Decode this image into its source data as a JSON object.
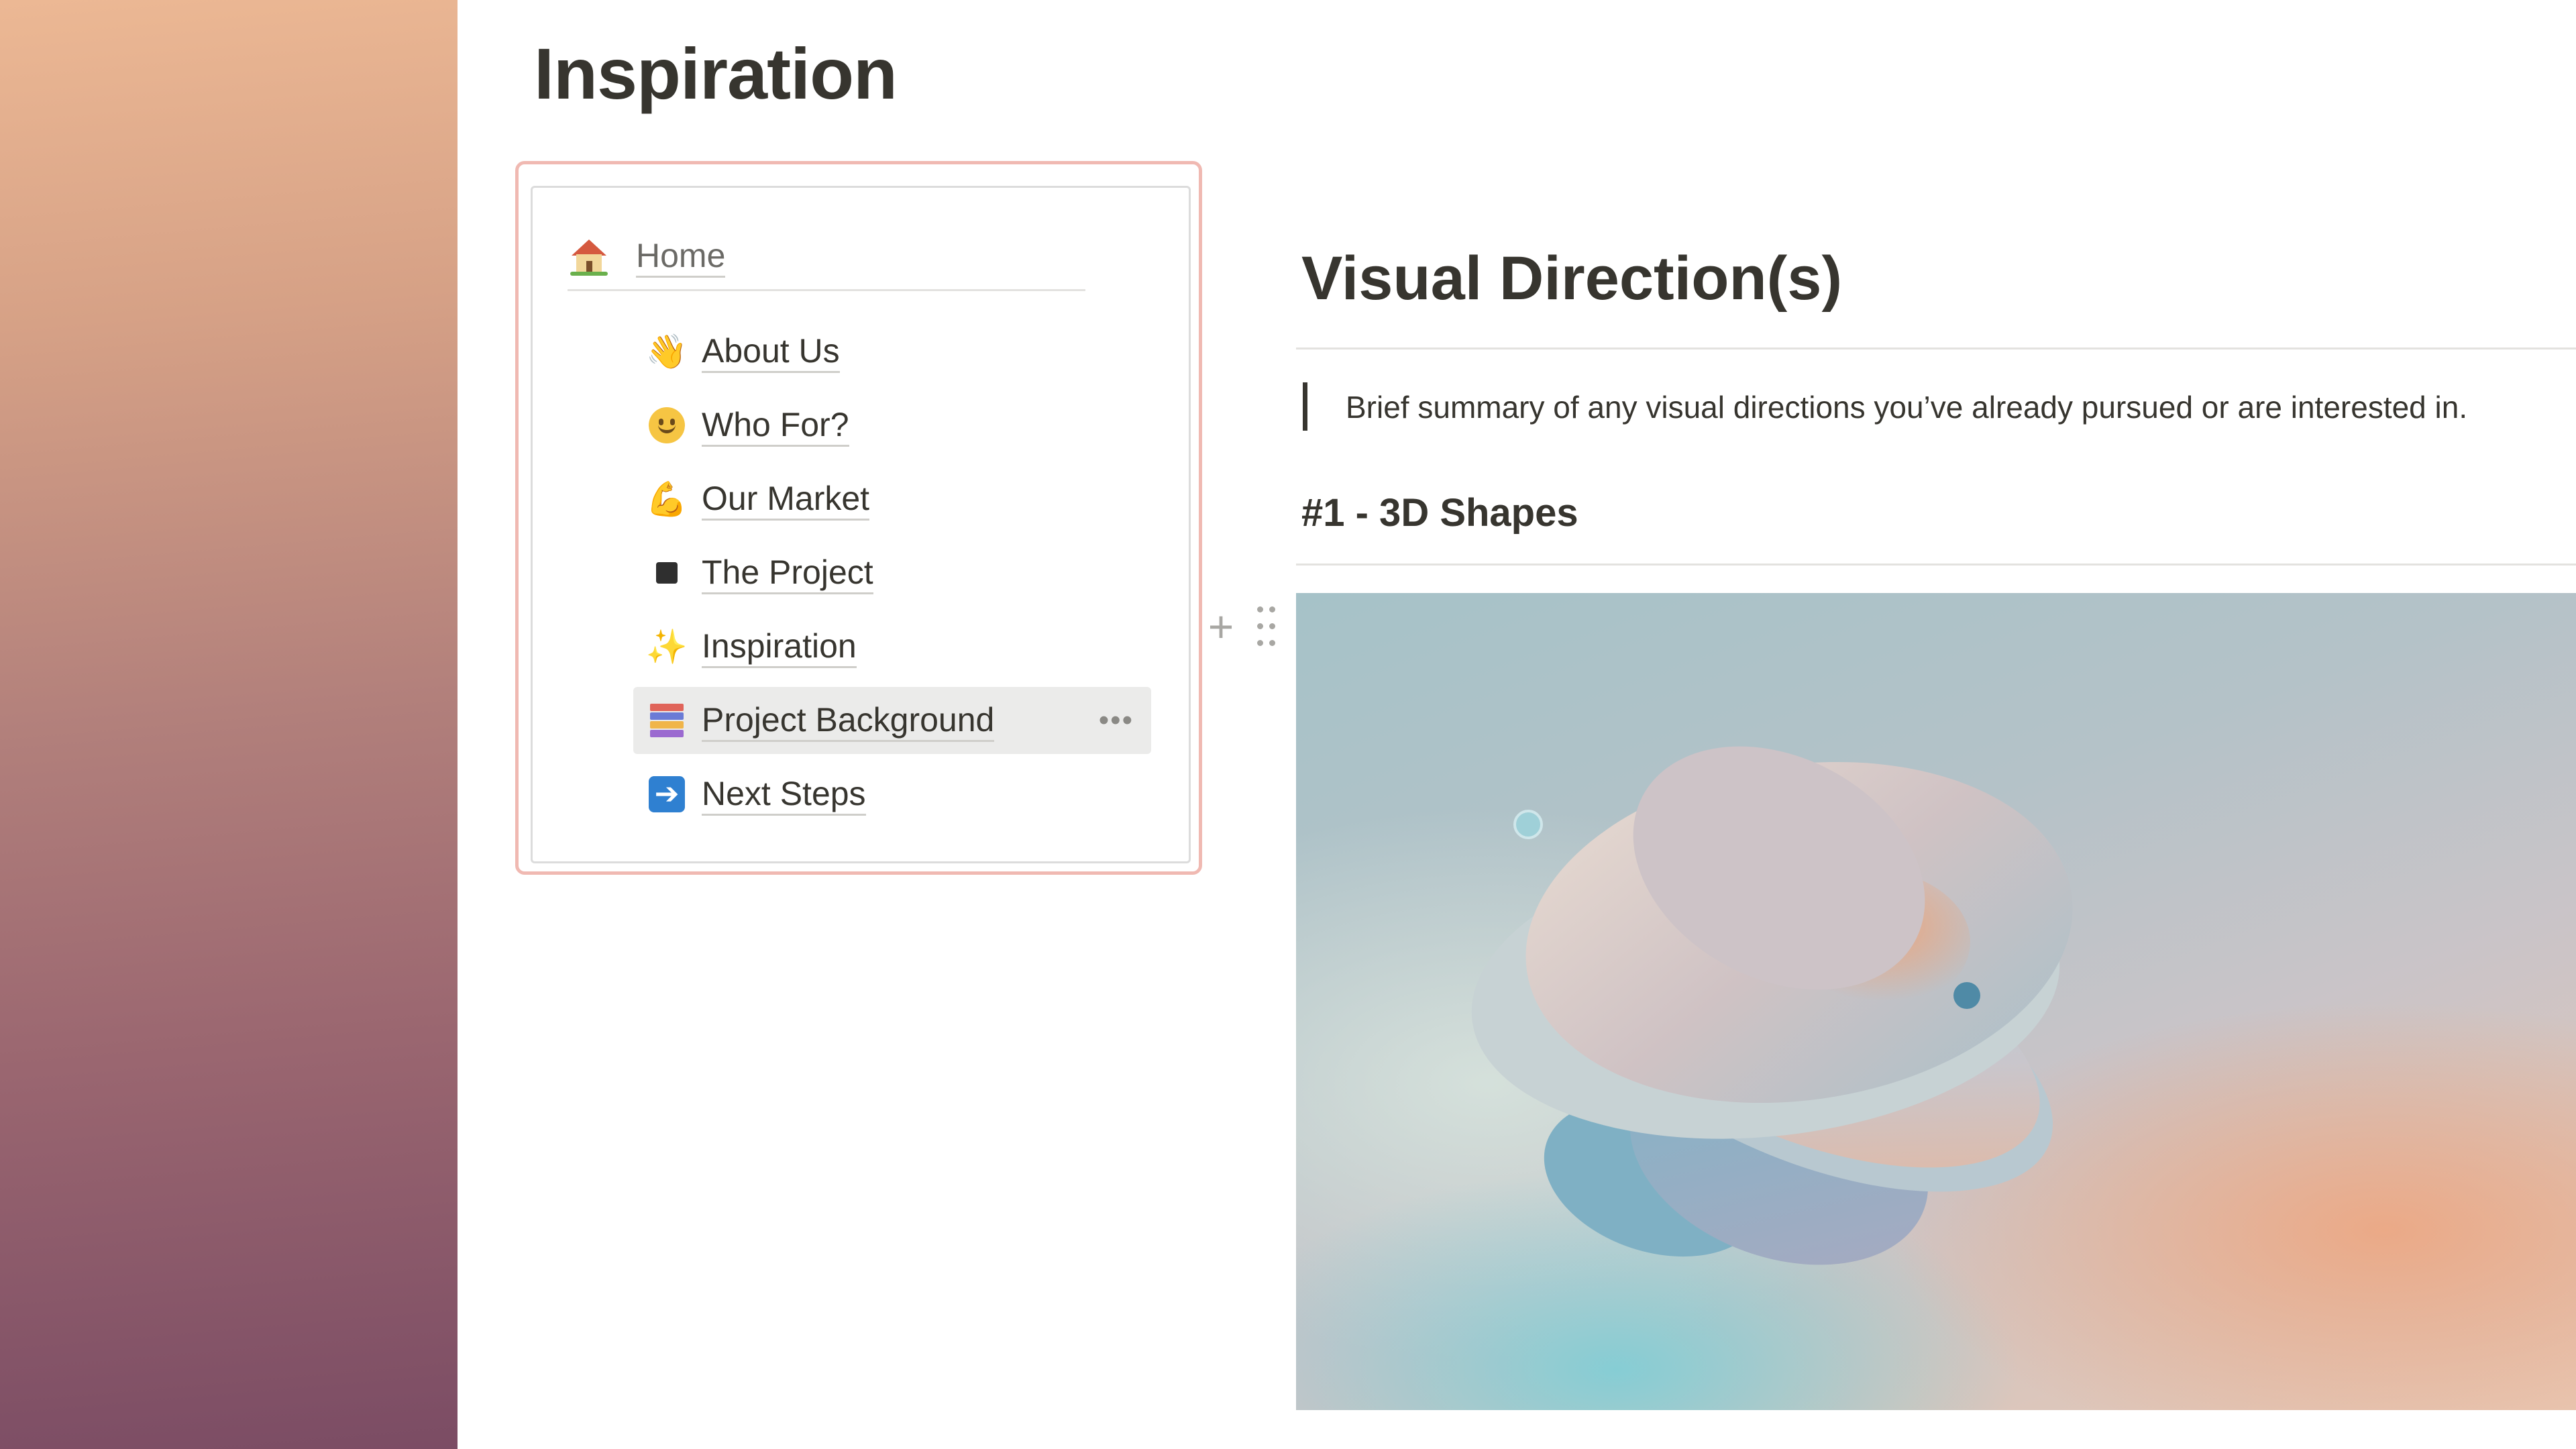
{
  "page": {
    "title": "Inspiration"
  },
  "toc": {
    "home": {
      "label": "Home",
      "icon": "house-icon"
    },
    "items": [
      {
        "label": "About Us",
        "icon": "waving-hand-icon"
      },
      {
        "label": "Who For?",
        "icon": "smiley-face-icon"
      },
      {
        "label": "Our Market",
        "icon": "flexed-biceps-icon"
      },
      {
        "label": "The Project",
        "icon": "black-square-icon"
      },
      {
        "label": "Inspiration",
        "icon": "sparkles-icon"
      },
      {
        "label": "Project Background",
        "icon": "books-icon",
        "hovered": true
      },
      {
        "label": "Next Steps",
        "icon": "right-arrow-icon"
      }
    ],
    "more_glyph": "•••"
  },
  "content": {
    "heading": "Visual Direction(s)",
    "quote": "Brief summary of any visual directions you’ve already pursued or are interested in.",
    "subheading": "#1 - 3D Shapes"
  },
  "block_controls": {
    "plus_glyph": "+"
  },
  "colors": {
    "accent_border": "#f0b9b2",
    "text": "#37352f",
    "hover_bg": "#ebebea"
  }
}
